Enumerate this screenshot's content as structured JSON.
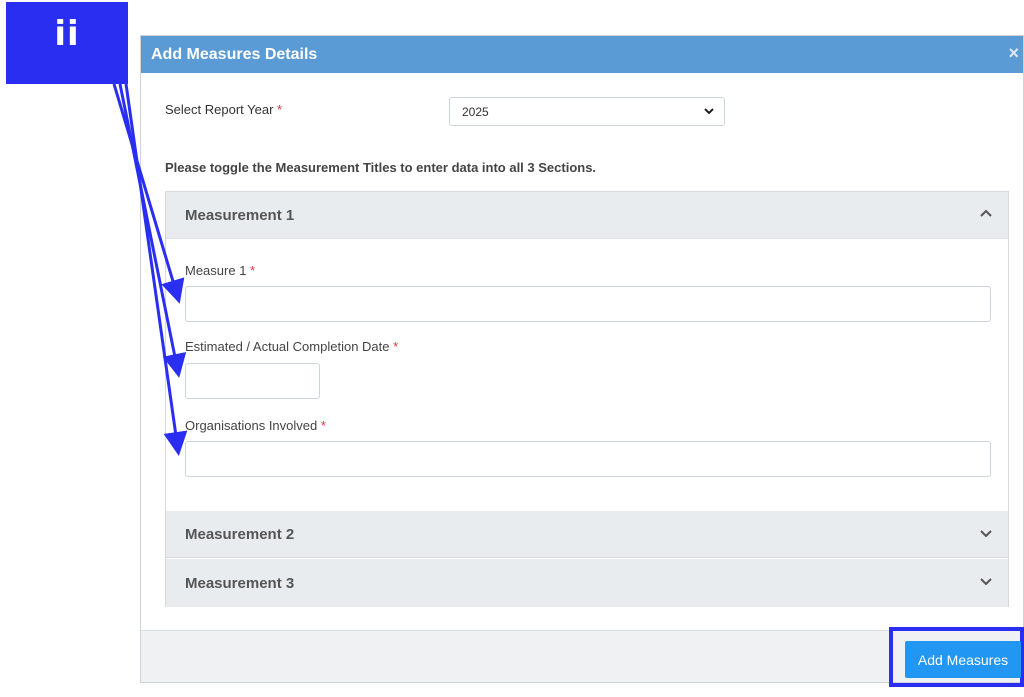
{
  "badge": {
    "text": "ii"
  },
  "modal": {
    "title": "Add Measures Details",
    "close_glyph": "×",
    "report_year": {
      "label": "Select Report Year",
      "required_mark": "*",
      "selected": "2025"
    },
    "instruction": "Please toggle the Measurement Titles to enter data into all 3 Sections.",
    "sections": [
      {
        "title": "Measurement 1",
        "expanded": true,
        "icon": "chevron-up-icon"
      },
      {
        "title": "Measurement 2",
        "expanded": false,
        "icon": "chevron-down-icon"
      },
      {
        "title": "Measurement 3",
        "expanded": false,
        "icon": "chevron-down-icon"
      }
    ],
    "fields": {
      "measure": {
        "label": "Measure 1",
        "required_mark": "*",
        "value": ""
      },
      "completion_date": {
        "label": "Estimated / Actual Completion Date",
        "required_mark": "*",
        "value": ""
      },
      "organisations": {
        "label": "Organisations Involved",
        "required_mark": "*",
        "value": ""
      }
    },
    "submit_label": "Add Measures"
  },
  "colors": {
    "header": "#5b9bd5",
    "annotation": "#2a2ef0",
    "button": "#2196f3",
    "required": "#d9363e"
  }
}
